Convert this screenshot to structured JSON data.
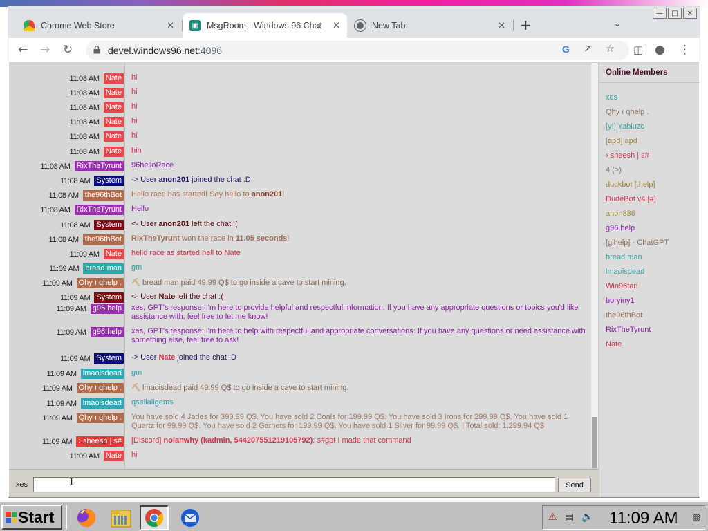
{
  "browser": {
    "tabs": [
      {
        "title": "Chrome Web Store",
        "active": false,
        "icon": "chrome-web-store-icon"
      },
      {
        "title": "MsgRoom - Windows 96 Chat",
        "active": true,
        "icon": "msgroom-icon"
      },
      {
        "title": "New Tab",
        "active": false,
        "icon": "chrome-icon"
      }
    ],
    "url": {
      "host": "devel.windows96.net",
      "port": ":4096"
    }
  },
  "chat": {
    "messages": [
      {
        "time": "11:08 AM",
        "user": "Nate",
        "color": "#e8474b",
        "text_color": "#d6324a",
        "text": "hi"
      },
      {
        "time": "11:08 AM",
        "user": "Nate",
        "color": "#e8474b",
        "text_color": "#d6324a",
        "text": "hi"
      },
      {
        "time": "11:08 AM",
        "user": "Nate",
        "color": "#e8474b",
        "text_color": "#d6324a",
        "text": "hi"
      },
      {
        "time": "11:08 AM",
        "user": "Nate",
        "color": "#e8474b",
        "text_color": "#d6324a",
        "text": "hi"
      },
      {
        "time": "11:08 AM",
        "user": "Nate",
        "color": "#e8474b",
        "text_color": "#d6324a",
        "text": "hi"
      },
      {
        "time": "11:08 AM",
        "user": "Nate",
        "color": "#e8474b",
        "text_color": "#d6324a",
        "text": "hih"
      },
      {
        "time": "11:08 AM",
        "user": "RixTheTyrunt",
        "color": "#9a2fb0",
        "text_color": "#8a20a8",
        "text": "96helloRace"
      },
      {
        "time": "11:08 AM",
        "user": "System",
        "color": "#0a0a7a",
        "text_color": "#1a1a6a",
        "html": "-> User <b>anon201</b> joined the chat :D"
      },
      {
        "time": "11:08 AM",
        "user": "the96thBot",
        "color": "#b26a4a",
        "text_color": "#b07050",
        "html": "Hello race has started! Say hello to <b style=\"color:#8a3a2a\">anon201</b>!"
      },
      {
        "time": "11:08 AM",
        "user": "RixTheTyrunt",
        "color": "#9a2fb0",
        "text_color": "#8a20a8",
        "text": "Hello"
      },
      {
        "time": "11:08 AM",
        "user": "System",
        "color": "#7a0a14",
        "text_color": "#5a0a10",
        "html": "<- User <b>anon201</b> left the chat :("
      },
      {
        "time": "11:08 AM",
        "user": "the96thBot",
        "color": "#b26a4a",
        "text_color": "#a06a5a",
        "html": "<b>RixTheTyrunt</b> won the race in <b>11.05 seconds</b>!"
      },
      {
        "time": "11:09 AM",
        "user": "Nate",
        "color": "#e8474b",
        "text_color": "#d6324a",
        "text": "hello race as started hell to Nate"
      },
      {
        "time": "11:09 AM",
        "user": "bread man",
        "color": "#2aa8a8",
        "text_color": "#2a9a9a",
        "text": "gm"
      },
      {
        "time": "11:09 AM",
        "user": "Qhy ı qhelp .",
        "color": "#b06a4a",
        "text_color": "#806a5a",
        "pick": true,
        "text": "bread man paid 49.99 Q$ to go inside a cave to start mining."
      },
      {
        "time": "11:09 AM",
        "user": "System",
        "color": "#7a0a14",
        "text_color": "#5a0a10",
        "html": "<- User <b>Nate</b> left the chat :("
      },
      {
        "time": "11:09 AM",
        "user": "g96.help",
        "color": "#9a2fb0",
        "text_color": "#8a20a8",
        "text": "xes, GPT's response: I'm here to provide helpful and respectful information. If you have any appropriate questions or topics you'd like assistance with, feel free to let me know!"
      },
      {
        "time": "11:09 AM",
        "user": "g96.help",
        "color": "#9a2fb0",
        "text_color": "#8a20a8",
        "text": "xes, GPT's response: I'm here to help with respectful and appropriate conversations. If you have any questions or need assistance with something else, feel free to ask!"
      },
      {
        "time": "11:09 AM",
        "user": "System",
        "color": "#0a0a7a",
        "text_color": "#1a1a6a",
        "html": "-> User <b style=\"color:#d6324a\">Nate</b> joined the chat :D"
      },
      {
        "time": "11:09 AM",
        "user": "lmaoisdead",
        "color": "#2aa8b8",
        "text_color": "#2a9aa8",
        "text": "gm"
      },
      {
        "time": "11:09 AM",
        "user": "Qhy ı qhelp .",
        "color": "#b06a4a",
        "text_color": "#806a5a",
        "pick": true,
        "text": "lmaoisdead paid 49.99 Q$ to go inside a cave to start mining."
      },
      {
        "time": "11:09 AM",
        "user": "lmaoisdead",
        "color": "#2aa8b8",
        "text_color": "#2a9aa8",
        "text": "qsellallgems"
      },
      {
        "time": "11:09 AM",
        "user": "Qhy ı qhelp .",
        "color": "#b06a4a",
        "text_color": "#a07a6a",
        "text": "You have sold 4 Jades for 399.99 Q$. You have sold 2 Coals for 199.99 Q$. You have sold 3 Irons for 299.99 Q$. You have sold 1 Quartz for 99.99 Q$. You have sold 2 Garnets for 199.99 Q$. You have sold 1 Silver for 99.99 Q$. | Total sold: 1,299.94 Q$"
      },
      {
        "time": "11:09 AM",
        "user": "› sheesh | s#",
        "color": "#e83a3a",
        "text_color": "#d6324a",
        "html": "[Discord] <b>nolanwhy (kadmin, 544207551219105792)</b>: s#gpt I made that command"
      },
      {
        "time": "11:09 AM",
        "user": "Nate",
        "color": "#e8474b",
        "text_color": "#d6324a",
        "text": "hi"
      }
    ],
    "input": {
      "nick": "xes",
      "value": "",
      "send_label": "Send"
    }
  },
  "members": {
    "title": "Online Members",
    "list": [
      {
        "name": "xes",
        "color": "#3aa0a0"
      },
      {
        "name": "Qhy ı qhelp .",
        "color": "#8a7060"
      },
      {
        "name": "[y!] Yabluzo",
        "color": "#3aa0a0"
      },
      {
        "name": "[apd] apd",
        "color": "#a08040"
      },
      {
        "name": "› sheesh | s#",
        "color": "#d6324a"
      },
      {
        "name": "4 (>)",
        "color": "#8a7060"
      },
      {
        "name": "duckbot [.help]",
        "color": "#a08040"
      },
      {
        "name": "DudeBot v4 [#]",
        "color": "#d6324a"
      },
      {
        "name": "anon836",
        "color": "#a09040"
      },
      {
        "name": "g96.help",
        "color": "#8a20a8"
      },
      {
        "name": "[glhelp] - ChatGPT",
        "color": "#8a7060"
      },
      {
        "name": "bread man",
        "color": "#3aa0a0"
      },
      {
        "name": "lmaoisdead",
        "color": "#3aa0a0"
      },
      {
        "name": "Win96fan",
        "color": "#d6324a"
      },
      {
        "name": "boryiny1",
        "color": "#8a20a8"
      },
      {
        "name": "the96thBot",
        "color": "#a06a5a"
      },
      {
        "name": "RixTheTyrunt",
        "color": "#8a20a8"
      },
      {
        "name": "Nate",
        "color": "#d6324a"
      }
    ]
  },
  "taskbar": {
    "start_label": "Start",
    "apps": [
      {
        "name": "firefox-icon",
        "active": false
      },
      {
        "name": "file-manager-icon",
        "active": false
      },
      {
        "name": "chrome-icon",
        "active": true
      },
      {
        "name": "thunderbird-icon",
        "active": false
      }
    ],
    "clock": "11:09 AM"
  }
}
